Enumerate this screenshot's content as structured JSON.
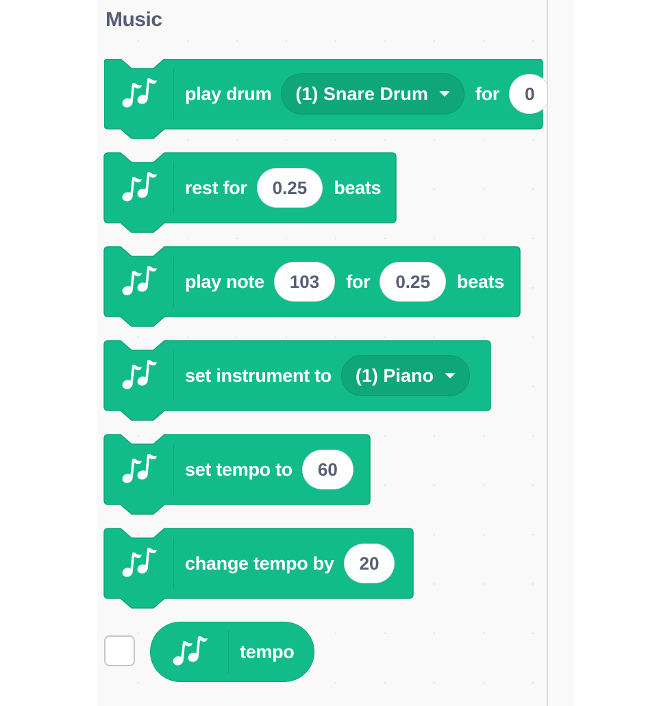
{
  "category": {
    "title": "Music",
    "color": "#12bc8a",
    "dark_color": "#0fa77a"
  },
  "icon": "music-notes-icon",
  "blocks": [
    {
      "id": "play-drum",
      "parts": [
        {
          "type": "label",
          "text": "play drum"
        },
        {
          "type": "dropdown",
          "value": "(1) Snare Drum"
        },
        {
          "type": "label",
          "text": "for"
        },
        {
          "type": "number",
          "value": "0"
        }
      ]
    },
    {
      "id": "rest-for",
      "parts": [
        {
          "type": "label",
          "text": "rest for"
        },
        {
          "type": "number",
          "value": "0.25"
        },
        {
          "type": "label",
          "text": "beats"
        }
      ]
    },
    {
      "id": "play-note",
      "parts": [
        {
          "type": "label",
          "text": "play note"
        },
        {
          "type": "number",
          "value": "103"
        },
        {
          "type": "label",
          "text": "for"
        },
        {
          "type": "number",
          "value": "0.25"
        },
        {
          "type": "label",
          "text": "beats"
        }
      ]
    },
    {
      "id": "set-instrument",
      "parts": [
        {
          "type": "label",
          "text": "set instrument to"
        },
        {
          "type": "dropdown",
          "value": "(1) Piano"
        }
      ]
    },
    {
      "id": "set-tempo",
      "parts": [
        {
          "type": "label",
          "text": "set tempo to"
        },
        {
          "type": "number",
          "value": "60"
        }
      ]
    },
    {
      "id": "change-tempo",
      "parts": [
        {
          "type": "label",
          "text": "change tempo by"
        },
        {
          "type": "number",
          "value": "20"
        }
      ]
    }
  ],
  "reporter": {
    "label": "tempo",
    "checked": false
  }
}
